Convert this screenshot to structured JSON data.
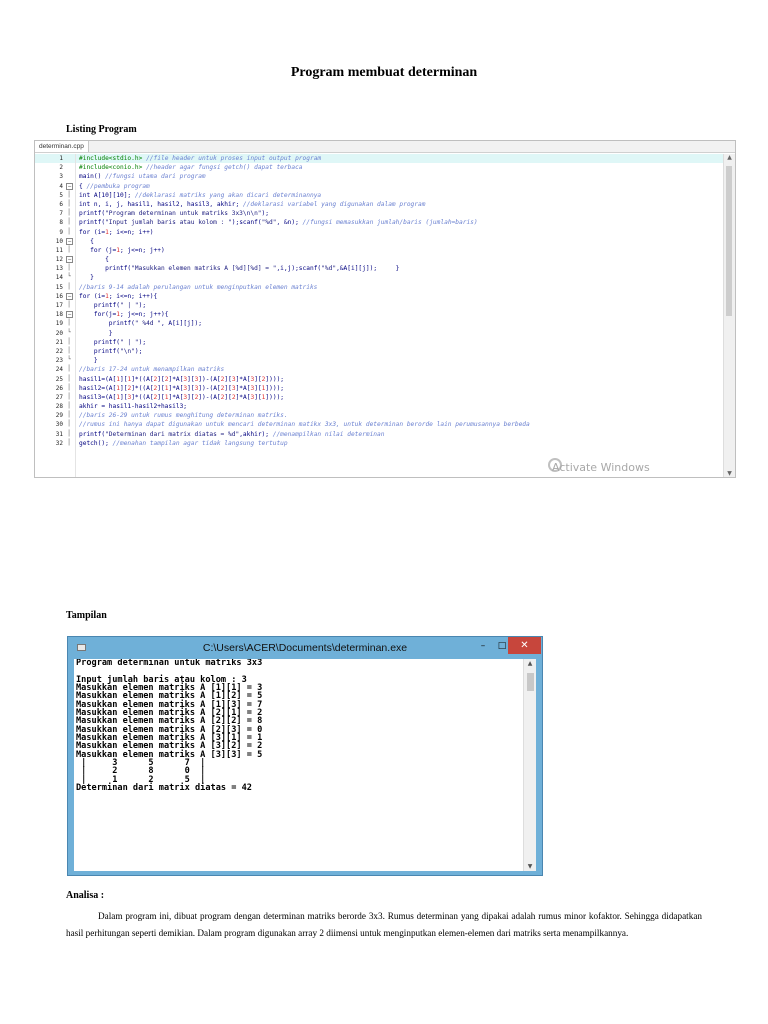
{
  "title": "Program membuat determinan",
  "listing_heading": "Listing Program",
  "editor": {
    "tab": "determinan.cpp",
    "lines": [
      {
        "n": "1",
        "fold": "",
        "segs": [
          [
            "dir",
            "#include<stdio.h> "
          ],
          [
            "com",
            "//file header untuk proses input output program"
          ]
        ]
      },
      {
        "n": "2",
        "fold": "",
        "segs": [
          [
            "dir",
            "#include<conio.h> "
          ],
          [
            "com",
            "//header agar fungsi getch() dapat terbaca"
          ]
        ]
      },
      {
        "n": "3",
        "fold": "",
        "segs": [
          [
            "kw",
            "main() "
          ],
          [
            "com",
            "//fungsi utama dari program"
          ]
        ]
      },
      {
        "n": "4",
        "fold": "box",
        "segs": [
          [
            "kw",
            "{ "
          ],
          [
            "com",
            "//pembuka program"
          ]
        ]
      },
      {
        "n": "5",
        "fold": "line",
        "segs": [
          [
            "kw",
            "int A[10][10]; "
          ],
          [
            "com",
            "//deklarasi matriks yang akan dicari determinannya"
          ]
        ]
      },
      {
        "n": "6",
        "fold": "line",
        "segs": [
          [
            "kw",
            "int n, i, j, hasil1, hasil2, hasil3, akhir; "
          ],
          [
            "com",
            "//deklarasi variabel yang digunakan dalam program"
          ]
        ]
      },
      {
        "n": "7",
        "fold": "line",
        "segs": [
          [
            "kw",
            "printf("
          ],
          [
            "str",
            "\"Program determinan untuk matriks 3x3\\n\\n\""
          ],
          [
            "kw",
            ");"
          ]
        ]
      },
      {
        "n": "8",
        "fold": "line",
        "segs": [
          [
            "kw",
            "printf("
          ],
          [
            "str",
            "\"Input jumlah baris atau kolom : \""
          ],
          [
            "kw",
            ");scanf("
          ],
          [
            "str",
            "\"%d\""
          ],
          [
            "kw",
            ", &n); "
          ],
          [
            "com",
            "//fungsi memasukkan jumlah/baris (jumlah=baris)"
          ]
        ]
      },
      {
        "n": "9",
        "fold": "line",
        "segs": [
          [
            "kw",
            "for (i="
          ],
          [
            "num",
            "1"
          ],
          [
            "kw",
            "; i<=n; i++)"
          ]
        ]
      },
      {
        "n": "10",
        "fold": "box",
        "segs": [
          [
            "kw",
            "   {"
          ]
        ]
      },
      {
        "n": "11",
        "fold": "line",
        "segs": [
          [
            "kw",
            "   for (j="
          ],
          [
            "num",
            "1"
          ],
          [
            "kw",
            "; j<=n; j++)"
          ]
        ]
      },
      {
        "n": "12",
        "fold": "box",
        "segs": [
          [
            "kw",
            "       {"
          ]
        ]
      },
      {
        "n": "13",
        "fold": "line",
        "segs": [
          [
            "kw",
            "       printf("
          ],
          [
            "str",
            "\"Masukkan elemen matriks A [%d][%d] = \""
          ],
          [
            "kw",
            ",i,j);scanf("
          ],
          [
            "str",
            "\"%d\""
          ],
          [
            "kw",
            ",&A[i][j]);     }"
          ]
        ]
      },
      {
        "n": "14",
        "fold": "end",
        "segs": [
          [
            "kw",
            "   }"
          ]
        ]
      },
      {
        "n": "15",
        "fold": "line",
        "segs": [
          [
            "com",
            "//baris 9-14 adalah perulangan untuk menginputkan elemen matriks"
          ]
        ]
      },
      {
        "n": "16",
        "fold": "box",
        "segs": [
          [
            "kw",
            "for (i="
          ],
          [
            "num",
            "1"
          ],
          [
            "kw",
            "; i<=n; i++){"
          ]
        ]
      },
      {
        "n": "17",
        "fold": "line",
        "segs": [
          [
            "kw",
            "    printf("
          ],
          [
            "str",
            "\" | \""
          ],
          [
            "kw",
            ");"
          ]
        ]
      },
      {
        "n": "18",
        "fold": "box",
        "segs": [
          [
            "kw",
            "    for(j="
          ],
          [
            "num",
            "1"
          ],
          [
            "kw",
            "; j<=n; j++){"
          ]
        ]
      },
      {
        "n": "19",
        "fold": "line",
        "segs": [
          [
            "kw",
            "        printf("
          ],
          [
            "str",
            "\" %4d \""
          ],
          [
            "kw",
            ", A[i][j]);"
          ]
        ]
      },
      {
        "n": "20",
        "fold": "end",
        "segs": [
          [
            "kw",
            "        }"
          ]
        ]
      },
      {
        "n": "21",
        "fold": "line",
        "segs": [
          [
            "kw",
            "    printf("
          ],
          [
            "str",
            "\" | \""
          ],
          [
            "kw",
            ");"
          ]
        ]
      },
      {
        "n": "22",
        "fold": "line",
        "segs": [
          [
            "kw",
            "    printf("
          ],
          [
            "str",
            "\"\\n\""
          ],
          [
            "kw",
            ");"
          ]
        ]
      },
      {
        "n": "23",
        "fold": "end",
        "segs": [
          [
            "kw",
            "    }"
          ]
        ]
      },
      {
        "n": "24",
        "fold": "line",
        "segs": [
          [
            "com",
            "//baris 17-24 untuk menampilkan matriks"
          ]
        ]
      },
      {
        "n": "25",
        "fold": "line",
        "segs": [
          [
            "kw",
            "hasil1=(A["
          ],
          [
            "num",
            "1"
          ],
          [
            "kw",
            "]["
          ],
          [
            "num",
            "1"
          ],
          [
            "kw",
            "]*((A["
          ],
          [
            "num",
            "2"
          ],
          [
            "kw",
            "]["
          ],
          [
            "num",
            "2"
          ],
          [
            "kw",
            "]*A["
          ],
          [
            "num",
            "3"
          ],
          [
            "kw",
            "]["
          ],
          [
            "num",
            "3"
          ],
          [
            "kw",
            "])-(A["
          ],
          [
            "num",
            "2"
          ],
          [
            "kw",
            "]["
          ],
          [
            "num",
            "3"
          ],
          [
            "kw",
            "]*A["
          ],
          [
            "num",
            "3"
          ],
          [
            "kw",
            "]["
          ],
          [
            "num",
            "2"
          ],
          [
            "kw",
            "])));"
          ]
        ]
      },
      {
        "n": "26",
        "fold": "line",
        "segs": [
          [
            "kw",
            "hasil2=(A["
          ],
          [
            "num",
            "1"
          ],
          [
            "kw",
            "]["
          ],
          [
            "num",
            "2"
          ],
          [
            "kw",
            "]*((A["
          ],
          [
            "num",
            "2"
          ],
          [
            "kw",
            "]["
          ],
          [
            "num",
            "1"
          ],
          [
            "kw",
            "]*A["
          ],
          [
            "num",
            "3"
          ],
          [
            "kw",
            "]["
          ],
          [
            "num",
            "3"
          ],
          [
            "kw",
            "])-(A["
          ],
          [
            "num",
            "2"
          ],
          [
            "kw",
            "]["
          ],
          [
            "num",
            "3"
          ],
          [
            "kw",
            "]*A["
          ],
          [
            "num",
            "3"
          ],
          [
            "kw",
            "]["
          ],
          [
            "num",
            "1"
          ],
          [
            "kw",
            "])));"
          ]
        ]
      },
      {
        "n": "27",
        "fold": "line",
        "segs": [
          [
            "kw",
            "hasil3=(A["
          ],
          [
            "num",
            "1"
          ],
          [
            "kw",
            "]["
          ],
          [
            "num",
            "3"
          ],
          [
            "kw",
            "]*((A["
          ],
          [
            "num",
            "2"
          ],
          [
            "kw",
            "]["
          ],
          [
            "num",
            "1"
          ],
          [
            "kw",
            "]*A["
          ],
          [
            "num",
            "3"
          ],
          [
            "kw",
            "]["
          ],
          [
            "num",
            "2"
          ],
          [
            "kw",
            "])-(A["
          ],
          [
            "num",
            "2"
          ],
          [
            "kw",
            "]["
          ],
          [
            "num",
            "2"
          ],
          [
            "kw",
            "]*A["
          ],
          [
            "num",
            "3"
          ],
          [
            "kw",
            "]["
          ],
          [
            "num",
            "1"
          ],
          [
            "kw",
            "])));"
          ]
        ]
      },
      {
        "n": "28",
        "fold": "line",
        "segs": [
          [
            "kw",
            "akhir = hasil1-hasil2+hasil3;"
          ]
        ]
      },
      {
        "n": "29",
        "fold": "line",
        "segs": [
          [
            "com",
            "//baris 26-29 untuk rumus menghitung determinan matriks."
          ]
        ]
      },
      {
        "n": "30",
        "fold": "line",
        "segs": [
          [
            "com",
            "//rumus ini hanya dapat digunakan untuk mencari determinan matikx 3x3, untuk determinan berorde lain perumusannya berbeda"
          ]
        ]
      },
      {
        "n": "31",
        "fold": "line",
        "segs": [
          [
            "kw",
            "printf("
          ],
          [
            "str",
            "\"Determinan dari matrix diatas = %d\""
          ],
          [
            "kw",
            ",akhir); "
          ],
          [
            "com",
            "//menampilkan nilai determinan"
          ]
        ]
      },
      {
        "n": "32",
        "fold": "line",
        "segs": [
          [
            "kw",
            "getch(); "
          ],
          [
            "com",
            "//menahan tampilan agar tidak langsung tertutup"
          ]
        ]
      }
    ],
    "watermark": "Activate Windows"
  },
  "tampilan_heading": "Tampilan",
  "console": {
    "title": "C:\\Users\\ACER\\Documents\\determinan.exe",
    "min": "–",
    "max": "□",
    "close": "✕",
    "lines": [
      "Program determinan untuk matriks 3x3",
      "",
      "Input jumlah baris atau kolom : 3",
      "Masukkan elemen matriks A [1][1] = 3",
      "Masukkan elemen matriks A [1][2] = 5",
      "Masukkan elemen matriks A [1][3] = 7",
      "Masukkan elemen matriks A [2][1] = 2",
      "Masukkan elemen matriks A [2][2] = 8",
      "Masukkan elemen matriks A [2][3] = 0",
      "Masukkan elemen matriks A [3][1] = 1",
      "Masukkan elemen matriks A [3][2] = 2",
      "Masukkan elemen matriks A [3][3] = 5",
      " |     3      5      7  |",
      " |     2      8      0  |",
      " |     1      2      5  |",
      "Determinan dari matrix diatas = 42"
    ]
  },
  "analysis_heading": "Analisa :",
  "analysis_text": "Dalam program ini, dibuat program dengan determinan matriks berorde 3x3. Rumus determinan yang dipakai adalah rumus minor kofaktor. Sehingga didapatkan hasil perhitungan seperti demikian. Dalam program digunakan array 2 diimensi untuk menginputkan elemen-elemen dari matriks serta menampilkannya."
}
